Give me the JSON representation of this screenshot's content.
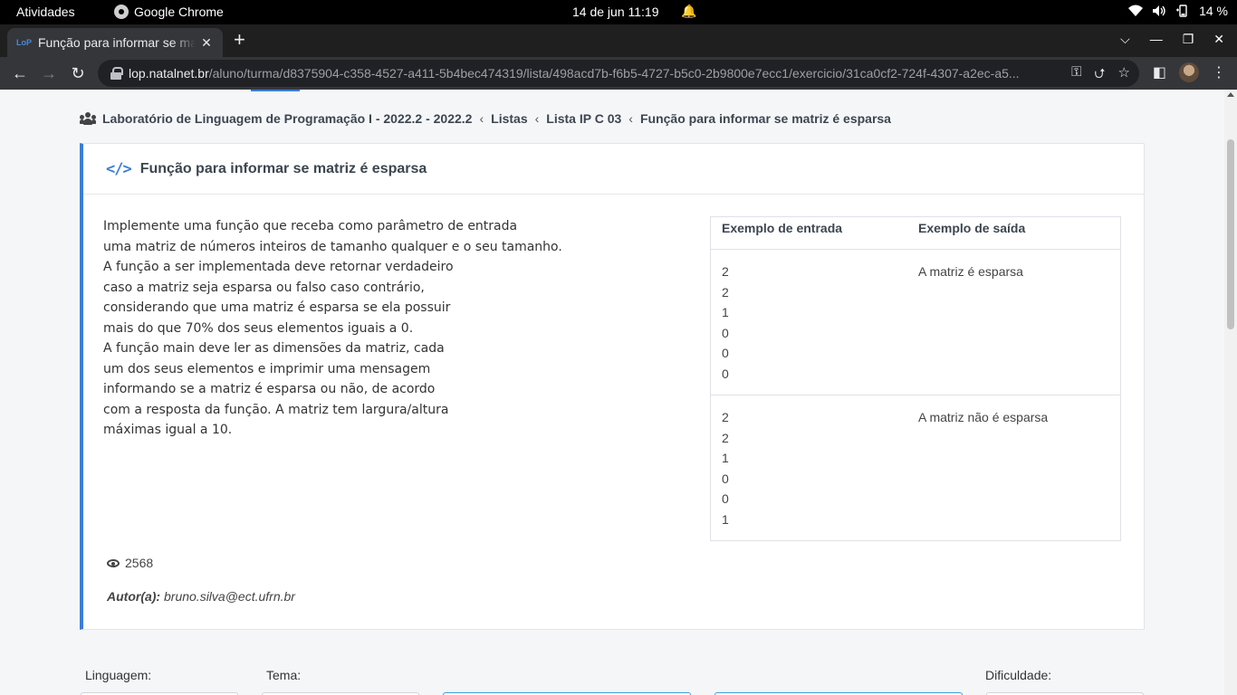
{
  "system_bar": {
    "activities": "Atividades",
    "app_name": "Google Chrome",
    "clock": "14 de jun  11:19",
    "battery": "14 %"
  },
  "browser": {
    "tab_title": "Função para informar se matriz é esparsa",
    "favicon_text": "LoP",
    "url_host": "lop.natalnet.br",
    "url_path": "/aluno/turma/d8375904-c358-4527-a411-5b4bec474319/lista/498acd7b-f6b5-4727-b5c0-2b9800e7ecc1/exercicio/31ca0cf2-724f-4307-a2ec-a5..."
  },
  "breadcrumb": {
    "items": [
      "Laboratório de Linguagem de Programação I - 2022.2 - 2022.2",
      "Listas",
      "Lista IP C 03",
      "Função para informar se matriz é esparsa"
    ]
  },
  "exercise": {
    "title": "Função para informar se matriz é esparsa",
    "description_lines": [
      "Implemente uma função que receba como parâmetro de entrada",
      "uma matriz de números inteiros de tamanho qualquer e o seu tamanho.",
      "A função a ser implementada deve retornar verdadeiro",
      "caso a matriz seja esparsa ou falso caso contrário,",
      "considerando que uma matriz é esparsa se ela possuir",
      "mais do que 70% dos seus elementos iguais a 0.",
      "A função main deve ler as dimensões da matriz, cada",
      "um dos seus elementos e imprimir uma mensagem",
      "informando se a matriz é esparsa ou não, de acordo",
      "com a resposta da função. A matriz tem largura/altura",
      "máximas igual a 10."
    ],
    "examples": {
      "header_input": "Exemplo de entrada",
      "header_output": "Exemplo de saída",
      "rows": [
        {
          "input": [
            "2",
            "2",
            "1",
            "0",
            "0",
            "0"
          ],
          "output": "A matriz é esparsa"
        },
        {
          "input": [
            "2",
            "2",
            "1",
            "0",
            "0",
            "1"
          ],
          "output": "A matriz não é esparsa"
        }
      ]
    },
    "views": "2568",
    "author_label": "Autor(a):",
    "author": "bruno.silva@ect.ufrn.br"
  },
  "filters": {
    "language_label": "Linguagem:",
    "theme_label": "Tema:",
    "difficulty_label": "Dificuldade:"
  }
}
